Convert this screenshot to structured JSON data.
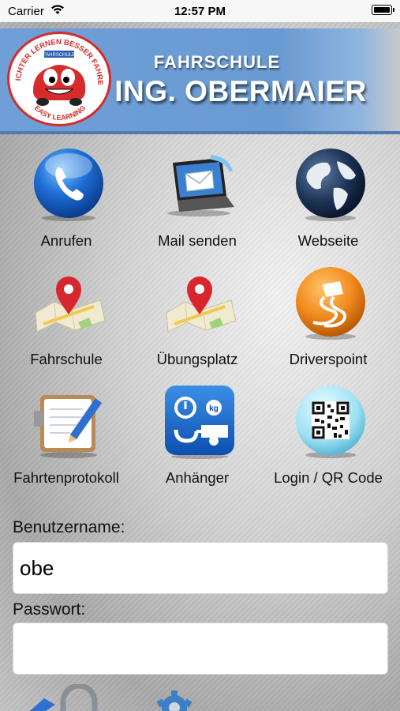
{
  "status_bar": {
    "carrier": "Carrier",
    "time": "12:57 PM"
  },
  "header": {
    "title_small": "FAHRSCHULE",
    "title_big": "ING. OBERMAIER",
    "logo_text_top": "LEICHTER LERNEN BESSER FAHREN",
    "logo_text_bottom": "EASY LEARNING",
    "logo_badge": "FAHRSCHULE"
  },
  "tiles": [
    {
      "label": "Anrufen",
      "icon": "phone-icon"
    },
    {
      "label": "Mail senden",
      "icon": "mail-laptop-icon"
    },
    {
      "label": "Webseite",
      "icon": "globe-icon"
    },
    {
      "label": "Fahrschule",
      "icon": "map-pin-icon"
    },
    {
      "label": "Übungsplatz",
      "icon": "map-pin-icon"
    },
    {
      "label": "Driverspoint",
      "icon": "skid-car-icon"
    },
    {
      "label": "Fahrtenprotokoll",
      "icon": "clipboard-pen-icon"
    },
    {
      "label": "Anhänger",
      "icon": "trailer-scale-icon"
    },
    {
      "label": "Login / QR Code",
      "icon": "qr-code-icon"
    }
  ],
  "form": {
    "username_label": "Benutzername:",
    "username_value": "obe",
    "password_label": "Passwort:",
    "password_value": ""
  },
  "colors": {
    "header_blue": "#6a9ad2",
    "logo_red": "#d62b2b",
    "accent_orange": "#f08a1c"
  }
}
